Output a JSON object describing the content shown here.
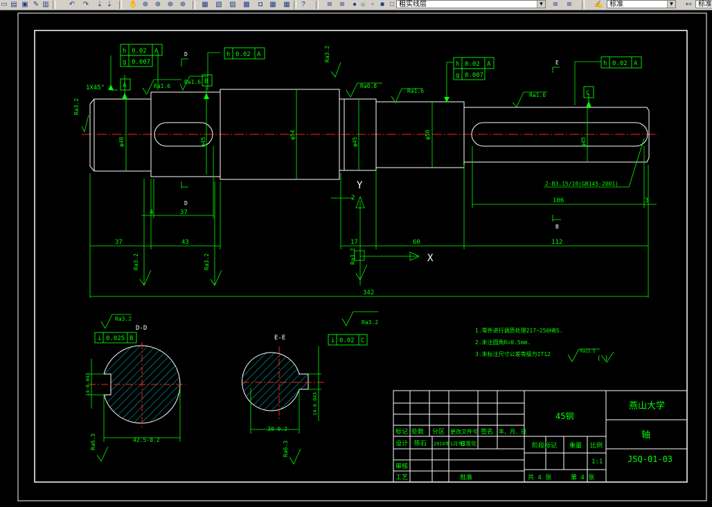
{
  "toolbar": {
    "layer_combo": "粗实线层",
    "style_combo": "标准",
    "third_combo": "标准"
  },
  "drawing": {
    "tol_h1": "h",
    "tol_h1v": "0.02",
    "tol_h1d": "A",
    "tol_g1": "g",
    "tol_g1v": "0.007",
    "tol_h2": "h",
    "tol_h2v": "0.02",
    "tol_h2d": "A",
    "tol_h3": "h",
    "tol_h3v": "0.02",
    "tol_h3d": "A",
    "tol_g3": "g",
    "tol_g3v": "0.007",
    "tol_h4": "h",
    "tol_h4v": "0.02",
    "tol_h4d": "A",
    "datum_a": "A",
    "datum_b": "B",
    "datum_c": "C",
    "chamfer": "1X45°",
    "ra16_a": "Ra1.6",
    "ra16_b": "Ra1.6",
    "ra16_c": "Ra1.6",
    "ra16_d": "Ra1.6",
    "ra08": "Ra0.8",
    "ra32_top": "Ra3.2",
    "ra32_left": "Ra3.2",
    "ra32_b1": "Ra3.2",
    "ra32_b2": "Ra3.2",
    "ra32_b3": "Ra3.2",
    "sec_d_top": "D",
    "sec_d_bot": "D",
    "sec_e_top": "E",
    "sec_b_bot": "B",
    "dim_37a": "37",
    "dim_43": "43",
    "dim_4": "4",
    "dim_37b": "37",
    "dim_17": "17",
    "dim_60": "60",
    "dim_112": "112",
    "dim_2": "2",
    "dim_106": "106",
    "dim_3": "3",
    "dim_342": "342",
    "dia_left": "φ48",
    "dia_mid": "φ54",
    "dia_right": "φ50",
    "dia_k1": "φ45",
    "dia_k2": "φ45",
    "dia_k3": "φ45",
    "centre_note": "2-B3.15/10(GB145-2001)",
    "ucs_y": "Y",
    "ucs_x": "X",
    "sec1_title": "D-D",
    "sec2_title": "E-E",
    "sec1_tol_i": "i",
    "sec1_tol_v": "0.025",
    "sec1_tol_d": "B",
    "sec2_tol_i": "i",
    "sec2_tol_v": "0.02",
    "sec2_tol_d": "C",
    "sec1_ra": "Ra3.2",
    "sec2_ra": "Ra3.2",
    "sec1_ra2": "Ra6.3",
    "sec2_ra2": "Ra6.3",
    "sec1_dim": "42.5-0.2",
    "sec2_dim": "30-0.2",
    "sec1_dimv": "14-0.043",
    "sec2_dimv": "14-0.043",
    "note1": "1.零件进行调质处理217~250HBS.",
    "note2": "2.未注圆角R=0.5mm.",
    "note3": "3.未标注尺寸公差等级为IT12",
    "rough_all": "Ra12.5",
    "rough_paren": "(  )"
  },
  "title_block": {
    "material": "45钢",
    "university": "燕山大学",
    "part_name": "轴",
    "drawing_no": "JSQ-01-03",
    "h_mark": "标记",
    "h_count": "处数",
    "h_zone": "分区",
    "h_doc": "更改文件号",
    "h_sign": "签名",
    "h_date": "年、月、日",
    "designer_lbl": "设计",
    "designer": "陈石",
    "design_date": "2010年1月7日",
    "std_lbl": "标准化",
    "stage_lbl": "阶段标记",
    "weight_lbl": "重量",
    "scale_lbl": "比例",
    "scale": "1:1",
    "review_lbl": "审核",
    "process_lbl": "工艺",
    "approve_lbl": "批准",
    "total_sheets": "共 4 张",
    "sheet_no": "第 4 张"
  }
}
